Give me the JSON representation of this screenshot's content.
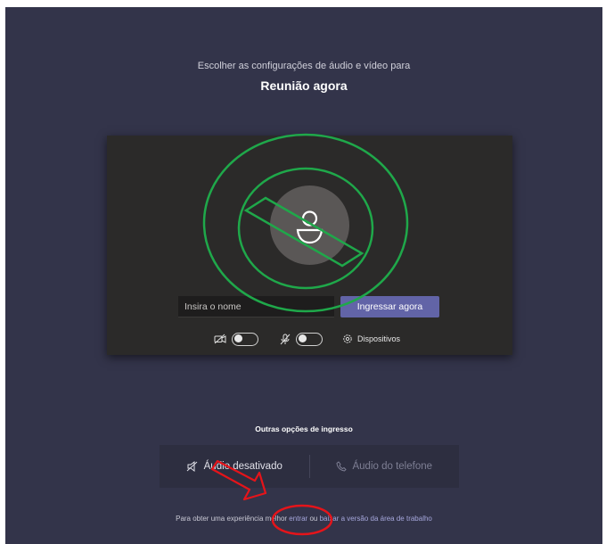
{
  "header": {
    "subtitle": "Escolher as configurações de áudio e vídeo para",
    "meeting_title": "Reunião agora"
  },
  "prejoin": {
    "name_placeholder": "Insira o nome",
    "join_label": "Ingressar agora",
    "camera_toggle_on": false,
    "mic_toggle_on": false,
    "devices_label": "Dispositivos"
  },
  "other_options": {
    "title": "Outras opções de ingresso",
    "audio_off_label": "Áudio desativado",
    "phone_audio_label": "Áudio do telefone"
  },
  "footer": {
    "prefix": "Para obter uma experiência melhor",
    "join_link": "entrar",
    "middle": "ou",
    "download_link": "baixar a versão da área de trabalho"
  },
  "colors": {
    "background": "#33344a",
    "card": "#2b2a29",
    "accent": "#6264a7",
    "annotation_green": "#1fa84a",
    "annotation_red": "#e5141a"
  },
  "annotations": {
    "green_symbol": "no-avatar-circle-slash",
    "red_arrow": "pointing-right",
    "red_ellipse": "circling-entrar-link"
  }
}
